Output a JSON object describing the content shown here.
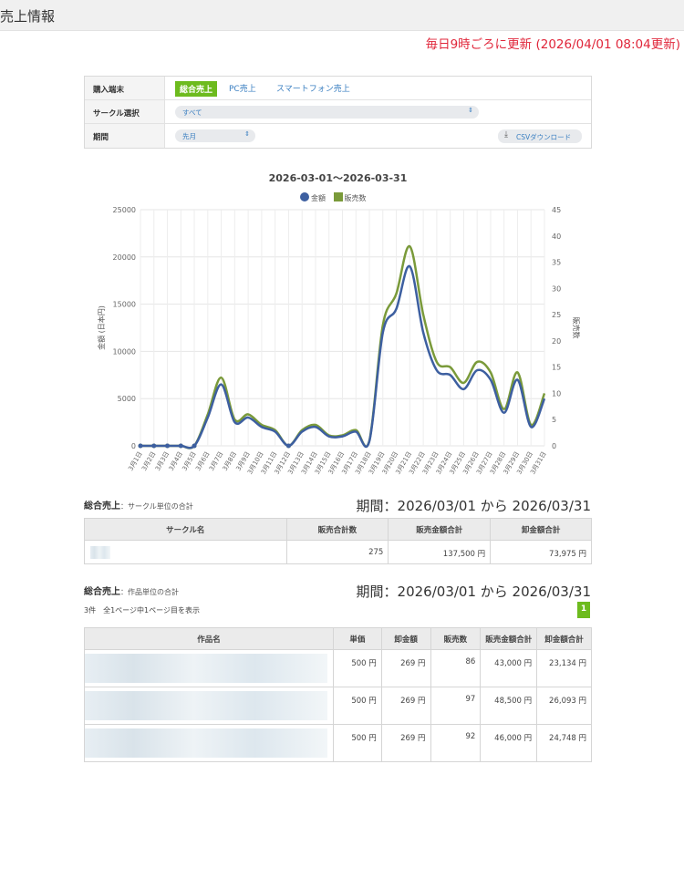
{
  "header": {
    "title": "売上情報",
    "update_note": "毎日9時ごろに更新 (2026/04/01 08:04更新)"
  },
  "filters": {
    "device_label": "購入端末",
    "tabs": [
      {
        "label": "総合売上",
        "active": true
      },
      {
        "label": "PC売上",
        "active": false
      },
      {
        "label": "スマートフォン売上",
        "active": false
      }
    ],
    "circle_label": "サークル選択",
    "circle_value": "すべて",
    "period_label": "期間",
    "period_value": "先月",
    "csv_label": "CSVダウンロード"
  },
  "chart_data": {
    "type": "line",
    "title": "2026-03-01〜2026-03-31",
    "legend_position": "top",
    "x": [
      "3月1日",
      "3月2日",
      "3月3日",
      "3月4日",
      "3月5日",
      "3月6日",
      "3月7日",
      "3月8日",
      "3月9日",
      "3月10日",
      "3月11日",
      "3月12日",
      "3月13日",
      "3月14日",
      "3月15日",
      "3月16日",
      "3月17日",
      "3月18日",
      "3月19日",
      "3月20日",
      "3月21日",
      "3月22日",
      "3月23日",
      "3月24日",
      "3月25日",
      "3月26日",
      "3月27日",
      "3月28日",
      "3月29日",
      "3月30日",
      "3月31日"
    ],
    "series": [
      {
        "name": "金額",
        "color": "#3d5fa0",
        "axis": "left",
        "values": [
          0,
          0,
          0,
          0,
          0,
          3000,
          6500,
          2500,
          3000,
          2000,
          1500,
          0,
          1500,
          2000,
          1000,
          1000,
          1500,
          500,
          12000,
          14500,
          19000,
          12000,
          8000,
          7500,
          6000,
          8000,
          7000,
          3500,
          7000,
          2000,
          5000
        ]
      },
      {
        "name": "販売数",
        "color": "#7a9a3a",
        "axis": "right",
        "values": [
          0,
          0,
          0,
          0,
          0,
          6,
          13,
          5,
          6,
          4,
          3,
          0,
          3,
          4,
          2,
          2,
          3,
          1,
          23,
          29,
          38,
          25,
          16,
          15,
          12,
          16,
          14,
          7,
          14,
          4,
          10
        ]
      }
    ],
    "ylabel": "金額 (日本円)",
    "ylabel_right": "販売数",
    "ylim": [
      0,
      25000
    ],
    "yticks": [
      "0",
      "5000",
      "10000",
      "15000",
      "20000",
      "25000"
    ],
    "ylim_right": [
      0,
      45
    ],
    "yticks_right": [
      "0",
      "5",
      "10",
      "15",
      "20",
      "25",
      "30",
      "35",
      "40",
      "45"
    ],
    "grid": true
  },
  "circle_section": {
    "title": "総合売上",
    "subtitle": "：サークル単位の合計",
    "period": "期間：2026/03/01 から 2026/03/31",
    "headers": [
      "サークル名",
      "販売合計数",
      "販売金額合計",
      "卸金額合計"
    ],
    "rows": [
      {
        "qty": "275",
        "sales": "137,500 円",
        "wholesale": "73,975 円"
      }
    ]
  },
  "work_section": {
    "title": "総合売上",
    "subtitle": "：作品単位の合計",
    "period": "期間：2026/03/01 から 2026/03/31",
    "count_note": "3件　全1ページ中1ページ目を表示",
    "page": "1",
    "headers": [
      "作品名",
      "単価",
      "卸金額",
      "販売数",
      "販売金額合計",
      "卸金額合計"
    ],
    "rows": [
      {
        "price": "500 円",
        "wholesale": "269 円",
        "qty": "86",
        "sales_total": "43,000 円",
        "wholesale_total": "23,134 円"
      },
      {
        "price": "500 円",
        "wholesale": "269 円",
        "qty": "97",
        "sales_total": "48,500 円",
        "wholesale_total": "26,093 円"
      },
      {
        "price": "500 円",
        "wholesale": "269 円",
        "qty": "92",
        "sales_total": "46,000 円",
        "wholesale_total": "24,748 円"
      }
    ]
  }
}
